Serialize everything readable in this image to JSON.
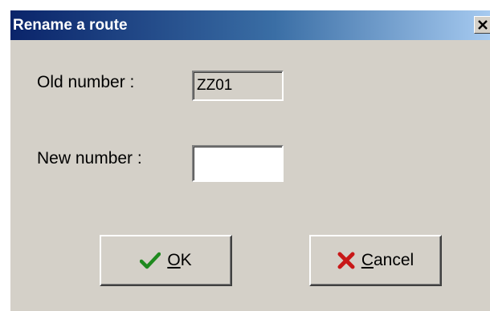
{
  "window": {
    "title": "Rename a route",
    "close_icon": "close-icon"
  },
  "form": {
    "old_number_label": "Old number :",
    "old_number_value": "ZZ01",
    "new_number_label": "New number :",
    "new_number_value": ""
  },
  "buttons": {
    "ok": {
      "icon": "checkmark-icon",
      "mnemonic": "O",
      "rest": "K"
    },
    "cancel": {
      "icon": "x-icon",
      "mnemonic": "C",
      "rest": "ancel"
    }
  },
  "colors": {
    "titlebar_start": "#0a246a",
    "titlebar_end": "#a6caf0",
    "dialog_face": "#d4d0c8",
    "ok_icon": "#1f8a1f",
    "cancel_icon": "#c81818"
  }
}
